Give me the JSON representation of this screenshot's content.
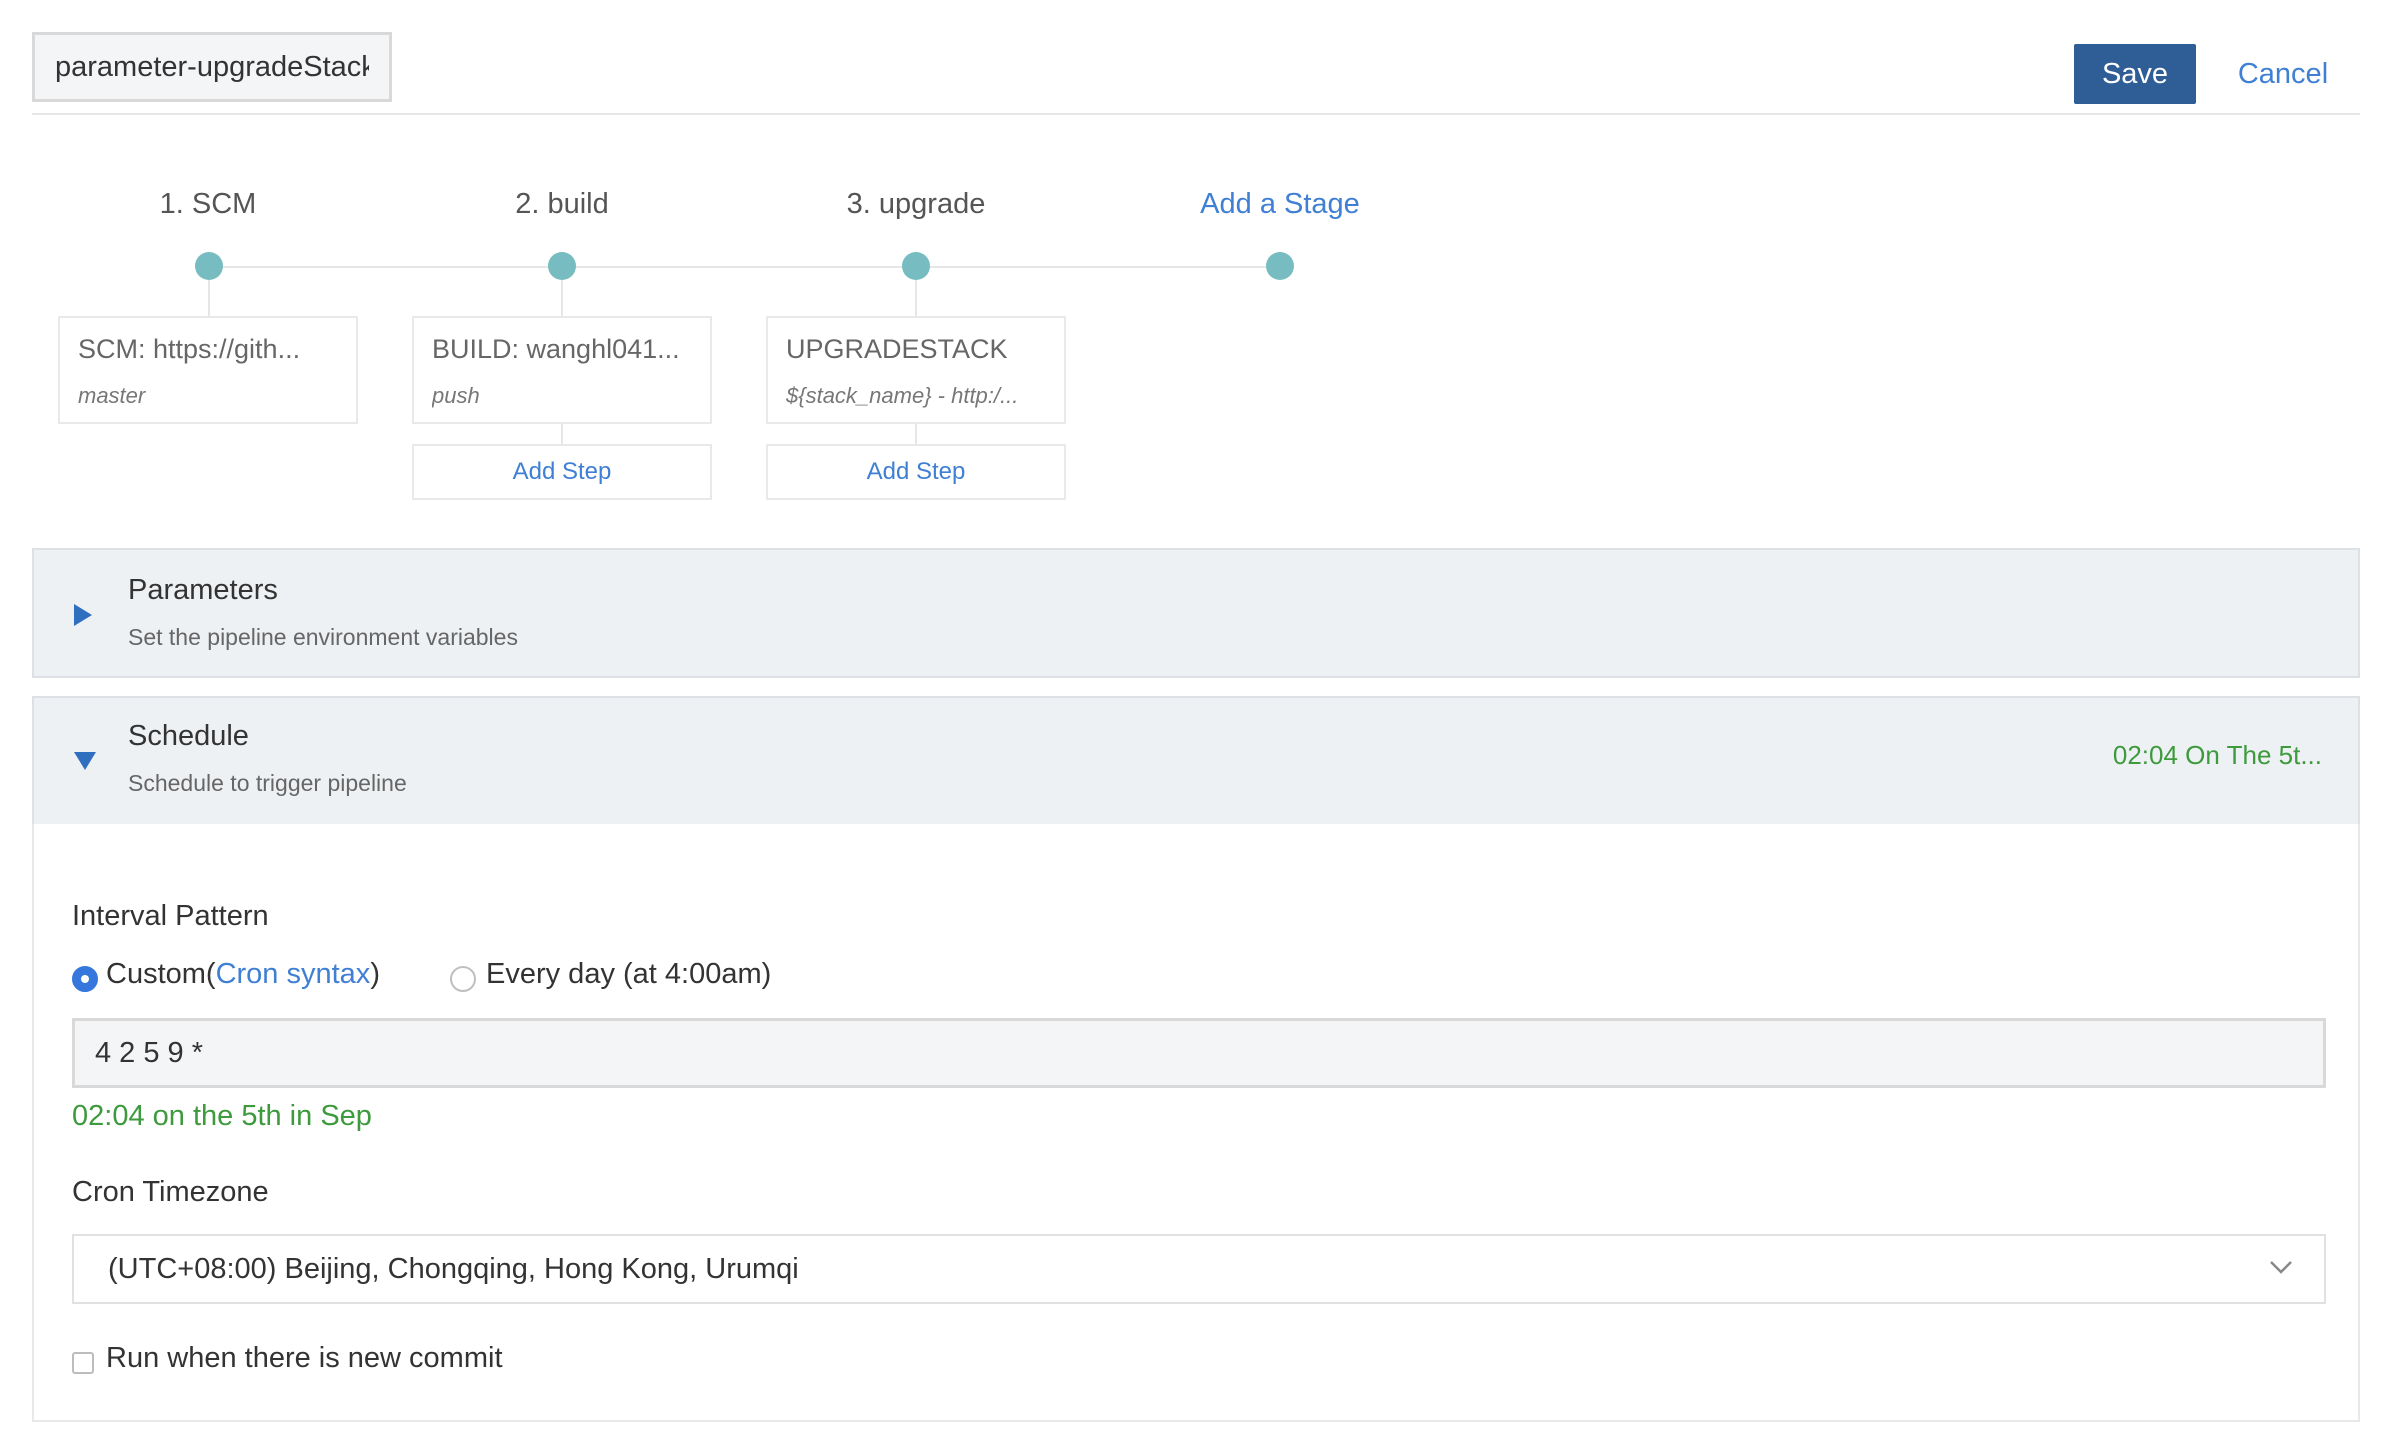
{
  "header": {
    "pipeline_name": "parameter-upgradeStack",
    "save_label": "Save",
    "cancel_label": "Cancel"
  },
  "stages": [
    {
      "title": "1. SCM",
      "step": {
        "title": "SCM: https://gith...",
        "sub": "master"
      }
    },
    {
      "title": "2. build",
      "step": {
        "title": "BUILD: wanghl041...",
        "sub": "push"
      },
      "add_step_label": "Add Step"
    },
    {
      "title": "3. upgrade",
      "step": {
        "title": "UPGRADESTACK",
        "sub": "${stack_name} - http:/..."
      },
      "add_step_label": "Add Step"
    }
  ],
  "add_stage_label": "Add a Stage",
  "parameters_panel": {
    "title": "Parameters",
    "description": "Set the pipeline environment variables"
  },
  "schedule_panel": {
    "title": "Schedule",
    "description": "Schedule to trigger pipeline",
    "summary": "02:04 On The 5t...",
    "interval_label": "Interval Pattern",
    "option_custom_prefix": "Custom(",
    "option_custom_link": "Cron syntax",
    "option_custom_suffix": ")",
    "option_daily": "Every day (at 4:00am)",
    "cron_value": "4 2 5 9 *",
    "cron_description": "02:04 on the 5th in Sep",
    "timezone_label": "Cron Timezone",
    "timezone_value": "(UTC+08:00) Beijing, Chongqing, Hong Kong, Urumqi",
    "new_commit_label": "Run when there is new commit"
  },
  "colors": {
    "accent": "#2f5e96",
    "link": "#3f7fd4",
    "success": "#3d9a3d",
    "stage_dot": "#77bcc0"
  }
}
